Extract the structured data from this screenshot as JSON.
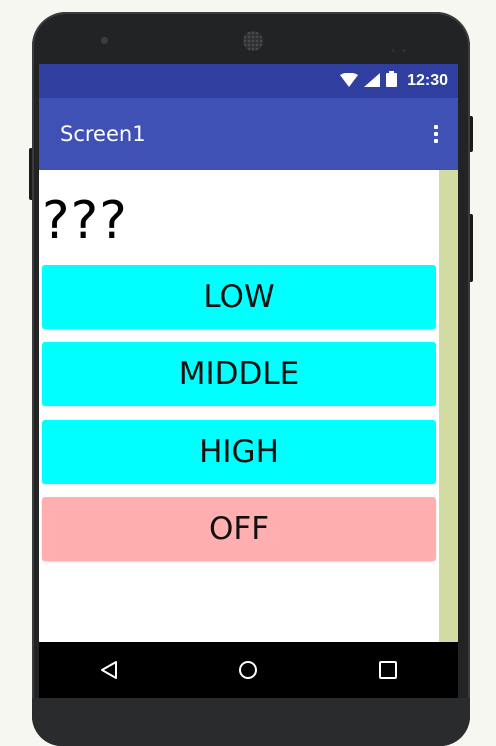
{
  "statusbar": {
    "time": "12:30",
    "icons": [
      "wifi-icon",
      "cell-signal-icon",
      "battery-icon"
    ]
  },
  "appbar": {
    "title": "Screen1",
    "menu_icon": "overflow-menu-icon"
  },
  "content": {
    "label": "???",
    "buttons": [
      {
        "label": "LOW",
        "color": "#00FFFF"
      },
      {
        "label": "MIDDLE",
        "color": "#00FFFF"
      },
      {
        "label": "HIGH",
        "color": "#00FFFF"
      },
      {
        "label": "OFF",
        "color": "#FFAFAF"
      }
    ]
  },
  "navbar": {
    "items": [
      "back-icon",
      "home-icon",
      "recents-icon"
    ]
  },
  "colors": {
    "statusbar": "#303F9F",
    "appbar": "#3F51B5",
    "scrollbar": "#D2DCA2"
  }
}
